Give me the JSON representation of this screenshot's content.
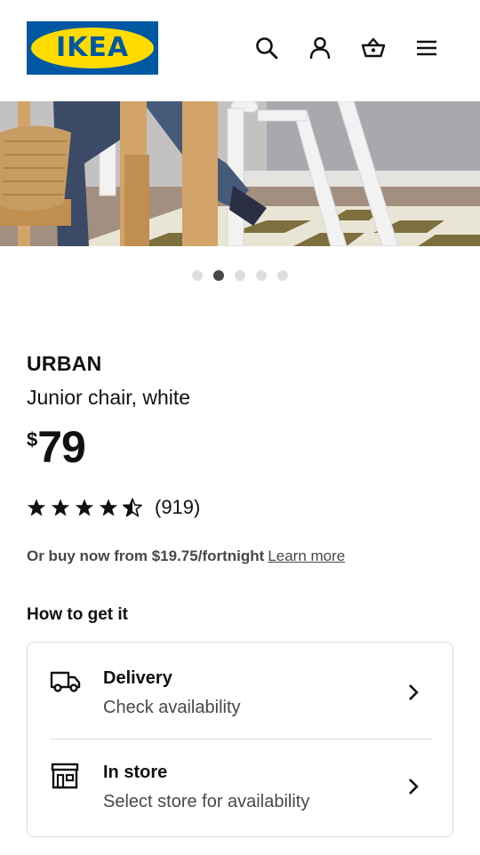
{
  "header": {
    "logo_text": "IKEA",
    "icons": [
      "search-icon",
      "user-icon",
      "basket-icon",
      "menu-icon"
    ],
    "brand_colors": {
      "blue": "#0058a3",
      "yellow": "#ffdb00"
    }
  },
  "carousel": {
    "total": 5,
    "active_index": 1
  },
  "product": {
    "name": "URBAN",
    "description": "Junior chair, white",
    "currency_symbol": "$",
    "price": "79",
    "rating_stars": 4.5,
    "rating_count": "(919)"
  },
  "finance": {
    "text": "Or buy now from $19.75/fortnight",
    "link": "Learn more"
  },
  "availability": {
    "heading": "How to get it",
    "delivery": {
      "title": "Delivery",
      "subtitle": "Check availability",
      "icon": "truck-icon"
    },
    "store": {
      "title": "In store",
      "subtitle": "Select store for availability",
      "icon": "store-icon"
    }
  }
}
